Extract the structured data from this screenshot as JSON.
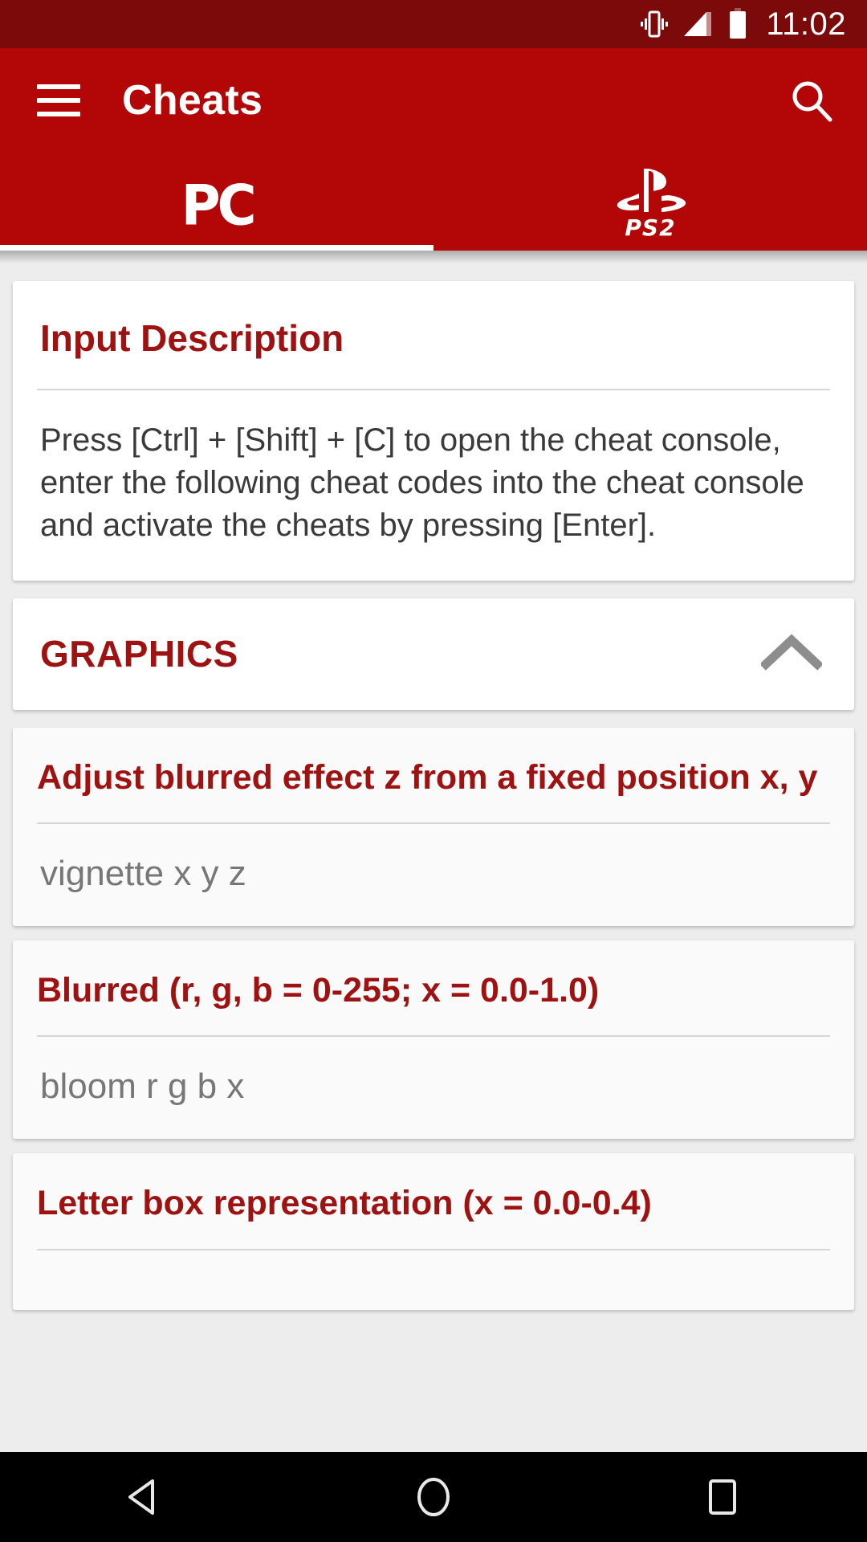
{
  "status_bar": {
    "time": "11:02",
    "icons": [
      "vibrate-icon",
      "signal-icon",
      "battery-icon"
    ],
    "background": "#7c0a0a"
  },
  "appbar": {
    "menu_icon": "hamburger-menu-icon",
    "title": "Cheats",
    "search_icon": "search-icon",
    "background": "#b30606"
  },
  "tabs": {
    "active_index": 0,
    "items": [
      {
        "label": "PC",
        "icon": "pc-logo-icon"
      },
      {
        "label": "PS2",
        "icon": "playstation-logo-icon"
      }
    ]
  },
  "content": {
    "info_card": {
      "title": "Input Description",
      "body": "Press [Ctrl] + [Shift] + [C] to open the cheat console, enter the following cheat codes into the cheat console and activate the cheats by pressing [Enter]."
    },
    "section": {
      "title": "GRAPHICS",
      "collapse_icon": "chevron-up-icon",
      "expanded": true
    },
    "cheats": [
      {
        "title": "Adjust blurred effect z from a fixed position x, y",
        "code": "vignette x y z"
      },
      {
        "title": "Blurred (r, g, b = 0-255; x = 0.0-1.0)",
        "code": "bloom r g b x"
      },
      {
        "title": "Letter box representation (x = 0.0-0.4)",
        "code": ""
      }
    ]
  },
  "navbar": {
    "back": "back-triangle-icon",
    "home": "home-circle-icon",
    "recents": "recents-square-icon"
  },
  "colors": {
    "primary": "#b30606",
    "primary_dark": "#7c0a0a",
    "accent_text": "#9e1212",
    "page_background": "#ededed"
  }
}
